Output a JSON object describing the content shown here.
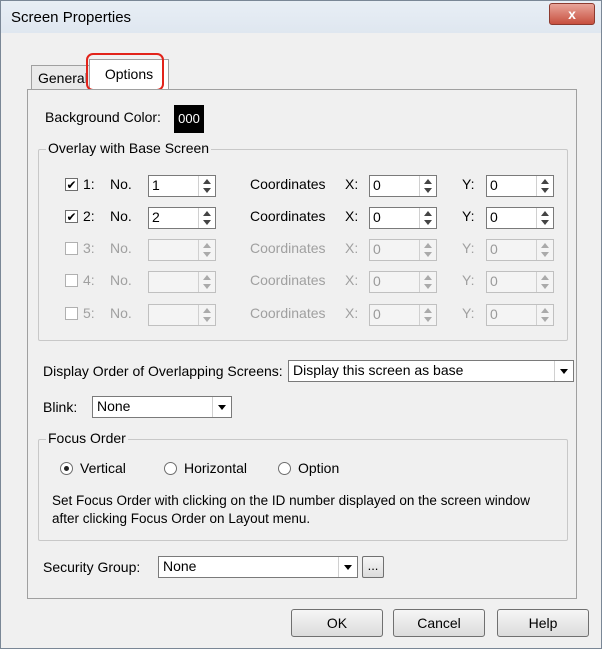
{
  "window": {
    "title": "Screen Properties",
    "close_glyph": "x"
  },
  "tabs": [
    {
      "label": "General"
    },
    {
      "label": "Options"
    }
  ],
  "background_color": {
    "label": "Background Color:",
    "value": "000"
  },
  "overlay": {
    "group_label": "Overlay with Base Screen",
    "rows": [
      {
        "checked": "✔",
        "index": "1:",
        "no_label": "No.",
        "no_value": "1",
        "coord_label": "Coordinates",
        "x_label": "X:",
        "x_value": "0",
        "y_label": "Y:",
        "y_value": "0"
      },
      {
        "checked": "✔",
        "index": "2:",
        "no_label": "No.",
        "no_value": "2",
        "coord_label": "Coordinates",
        "x_label": "X:",
        "x_value": "0",
        "y_label": "Y:",
        "y_value": "0"
      },
      {
        "checked": "",
        "index": "3:",
        "no_label": "No.",
        "no_value": "",
        "coord_label": "Coordinates",
        "x_label": "X:",
        "x_value": "0",
        "y_label": "Y:",
        "y_value": "0"
      },
      {
        "checked": "",
        "index": "4:",
        "no_label": "No.",
        "no_value": "",
        "coord_label": "Coordinates",
        "x_label": "X:",
        "x_value": "0",
        "y_label": "Y:",
        "y_value": "0"
      },
      {
        "checked": "",
        "index": "5:",
        "no_label": "No.",
        "no_value": "",
        "coord_label": "Coordinates",
        "x_label": "X:",
        "x_value": "0",
        "y_label": "Y:",
        "y_value": "0"
      }
    ]
  },
  "display_order": {
    "label": "Display Order of Overlapping Screens:",
    "value": "Display this screen as base"
  },
  "blink": {
    "label": "Blink:",
    "value": "None"
  },
  "focus_order": {
    "group_label": "Focus Order",
    "options": [
      "Vertical",
      "Horizontal",
      "Option"
    ],
    "selected": "Vertical",
    "description_line1": "Set Focus Order with clicking on the ID number displayed on the screen window",
    "description_line2": "after clicking Focus Order on Layout menu."
  },
  "security_group": {
    "label": "Security Group:",
    "value": "None",
    "browse_label": "..."
  },
  "buttons": {
    "ok": "OK",
    "cancel": "Cancel",
    "help": "Help"
  },
  "colors": {
    "highlight": "#e2231a",
    "close_button": "#c7503f"
  }
}
